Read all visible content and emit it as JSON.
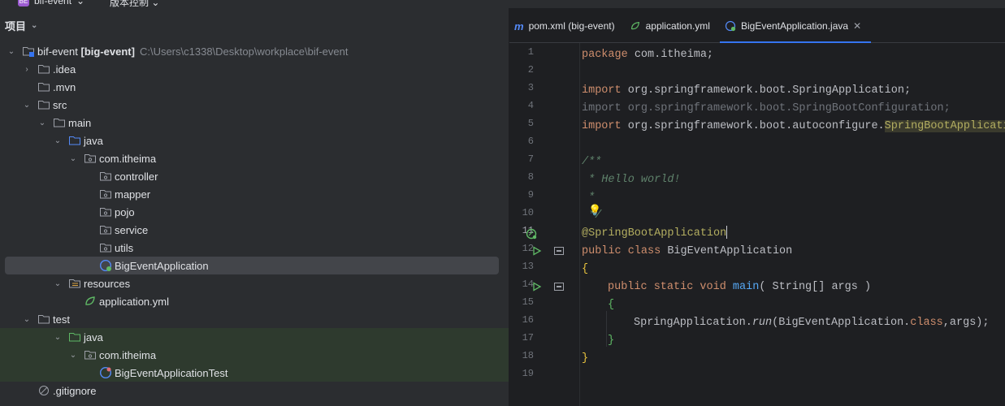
{
  "titlebar": {
    "badge": "BE",
    "project": "bif-event",
    "vcs": "版本控制"
  },
  "project_panel": {
    "title": "项目",
    "root": {
      "name": "bif-event",
      "module": "[big-event]",
      "path": "C:\\Users\\c1338\\Desktop\\workplace\\bif-event"
    },
    "items": [
      {
        "label": ".idea"
      },
      {
        "label": ".mvn"
      },
      {
        "label": "src"
      },
      {
        "label": "main"
      },
      {
        "label": "java"
      },
      {
        "label": "com.itheima"
      },
      {
        "label": "controller"
      },
      {
        "label": "mapper"
      },
      {
        "label": "pojo"
      },
      {
        "label": "service"
      },
      {
        "label": "utils"
      },
      {
        "label": "BigEventApplication"
      },
      {
        "label": "resources"
      },
      {
        "label": "application.yml"
      },
      {
        "label": "test"
      },
      {
        "label": "java"
      },
      {
        "label": "com.itheima"
      },
      {
        "label": "BigEventApplicationTest"
      },
      {
        "label": ".gitignore"
      }
    ]
  },
  "tabs": [
    {
      "label": "pom.xml (big-event)",
      "icon": "maven-icon"
    },
    {
      "label": "application.yml",
      "icon": "spring-config-icon"
    },
    {
      "label": "BigEventApplication.java",
      "icon": "spring-boot-class-icon",
      "active": true
    }
  ],
  "editor": {
    "line_numbers": [
      "1",
      "2",
      "3",
      "4",
      "5",
      "6",
      "7",
      "8",
      "9",
      "10",
      "11",
      "12",
      "13",
      "14",
      "15",
      "16",
      "17",
      "18",
      "19"
    ],
    "lines": {
      "l1_kw": "package",
      "l1_rest": " com.itheima;",
      "l3_kw": "import",
      "l3_rest": " org.springframework.boot.SpringApplication;",
      "l4": "import org.springframework.boot.SpringBootConfiguration;",
      "l5_kw": "import",
      "l5_rest": " org.springframework.boot.autoconfigure.",
      "l5_hl": "SpringBootApplicati",
      "l7": "/**",
      "l8": " * Hello world!",
      "l9": " *",
      "l10": " */",
      "l11": "@SpringBootApplication",
      "l12_kw": "public class",
      "l12_rest": " BigEventApplication",
      "l13": "{",
      "l14_kw": "public static void",
      "l14_fn": " main",
      "l14_rest": "( String[] args )",
      "l15": "{",
      "l16_a": "SpringApplication.",
      "l16_fn": "run",
      "l16_b": "(BigEventApplication.",
      "l16_kw": "class",
      "l16_c": ",args);",
      "l17": "}",
      "l18": "}"
    }
  },
  "colors": {
    "accent": "#3574f0",
    "keyword": "#cf8e6d",
    "annotation": "#b3ae60",
    "comment": "#5f826b",
    "run": "#5fb865"
  }
}
